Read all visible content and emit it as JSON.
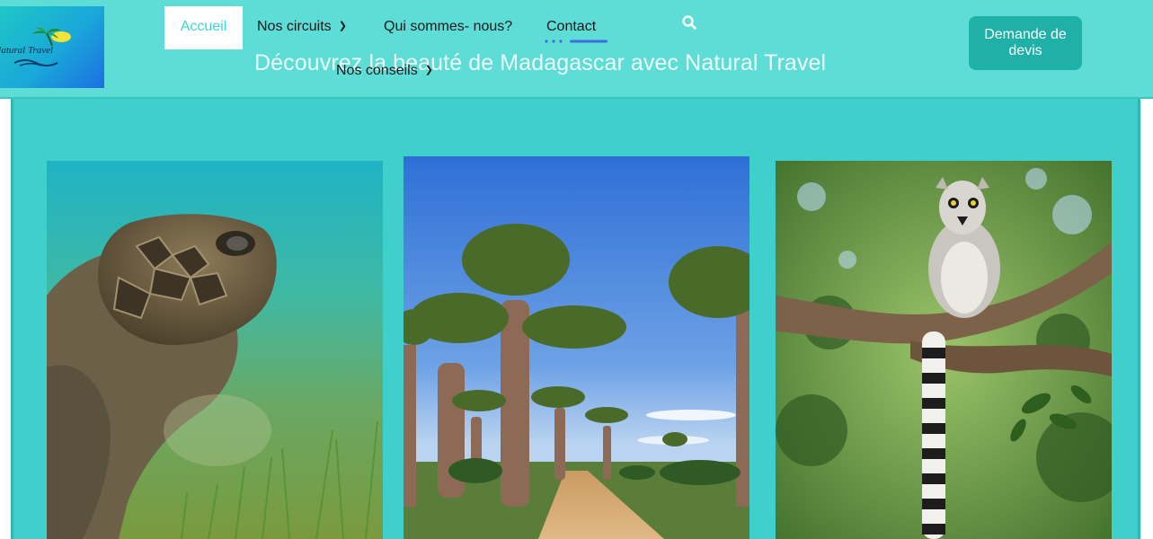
{
  "brand": {
    "logo_text": "Natural Travel"
  },
  "nav": {
    "items": [
      {
        "label": "Accueil",
        "active": true
      },
      {
        "label": "Nos circuits",
        "has_dropdown": true
      },
      {
        "label": "Qui sommes- nous?"
      },
      {
        "label": "Contact"
      },
      {
        "label": "Nos conseils",
        "has_dropdown": true
      }
    ],
    "search_icon": "search-icon"
  },
  "hero": {
    "title": "Découvrez la beauté de Madagascar avec Natural Travel"
  },
  "cta": {
    "label": "Demande de devis"
  },
  "gallery": {
    "images": [
      {
        "subject": "sea-turtle-photo"
      },
      {
        "subject": "baobab-avenue-photo"
      },
      {
        "subject": "ring-tailed-lemur-photo"
      }
    ]
  },
  "colors": {
    "page_bg": "#40d0cc",
    "header_bg": "#5edcd6",
    "button_bg": "#1fb0a7",
    "active_text": "#3ad6d2",
    "underline": "#3b6fe0"
  }
}
